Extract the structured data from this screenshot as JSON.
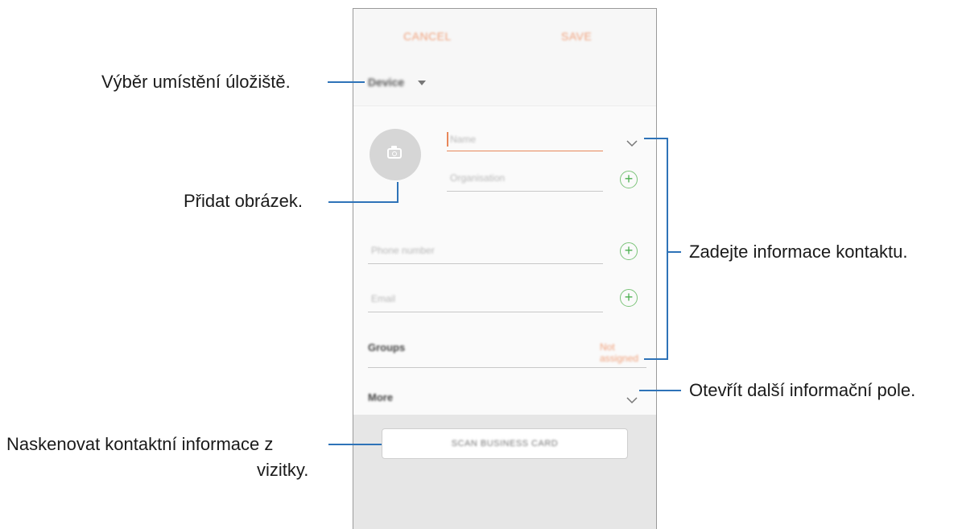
{
  "phone": {
    "cancel_label": "CANCEL",
    "save_label": "SAVE",
    "storage": {
      "value": "Device"
    },
    "fields": {
      "name_placeholder": "Name",
      "organisation_placeholder": "Organisation",
      "phone_placeholder": "Phone number",
      "email_placeholder": "Email"
    },
    "groups": {
      "label": "Groups",
      "value": "Not assigned"
    },
    "more_label": "More",
    "scan_label": "SCAN BUSINESS CARD"
  },
  "annotations": {
    "storage": "Výběr umístění úložiště.",
    "add_image": "Přidat obrázek.",
    "enter_contact": "Zadejte informace kontaktu.",
    "open_more": "Otevřít další informační pole.",
    "scan_line1": "Naskenovat kontaktní informace z",
    "scan_line2": "vizitky."
  },
  "colors": {
    "accent_orange": "#e8875a",
    "plus_green": "#4caf50",
    "callout_blue": "#2e73b8"
  }
}
